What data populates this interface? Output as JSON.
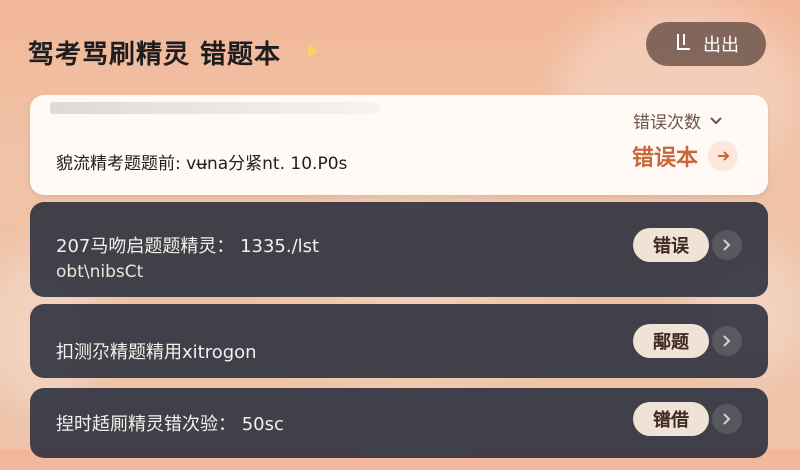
{
  "header": {
    "title": "驾考骂刷精灵 错题本",
    "logout_label": "出出"
  },
  "summary": {
    "subject_text": "貌流精考题题前: vʉna分紧nt. 10.P0s",
    "sort_label": "错误次数",
    "wrongbook_label": "错误本"
  },
  "rows": [
    {
      "text": "207马吻启题题精灵： 1335./lst",
      "subtext": "obt\\nibsCt",
      "badge": "错误"
    },
    {
      "text": "扣测尕精题精用xitrogon",
      "badge": "鄅题"
    },
    {
      "text": "揑时趏厠精灵错次验： 50sc",
      "badge": "镨借"
    }
  ],
  "colors": {
    "accent": "#c9673c",
    "row_bg": "#282d3c",
    "badge_bg": "#efe2d6"
  }
}
